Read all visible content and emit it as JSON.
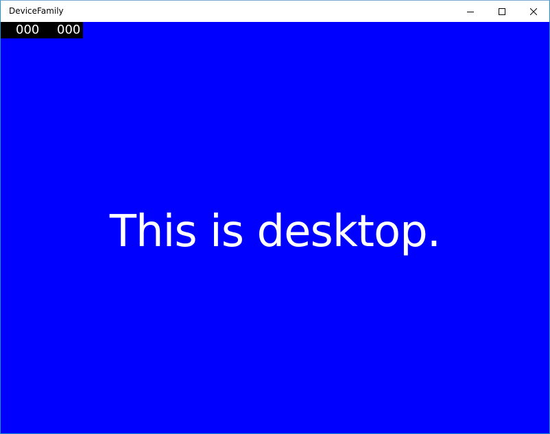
{
  "window": {
    "title": "DeviceFamily"
  },
  "caption_buttons": {
    "minimize_icon": "minimize-icon",
    "maximize_icon": "maximize-icon",
    "close_icon": "close-icon"
  },
  "frame_counter": {
    "left_value": "000",
    "right_value": "000"
  },
  "main": {
    "message": "This is desktop."
  },
  "colors": {
    "background": "#0000ff",
    "text": "#ffffff",
    "counter_background": "#000000"
  }
}
